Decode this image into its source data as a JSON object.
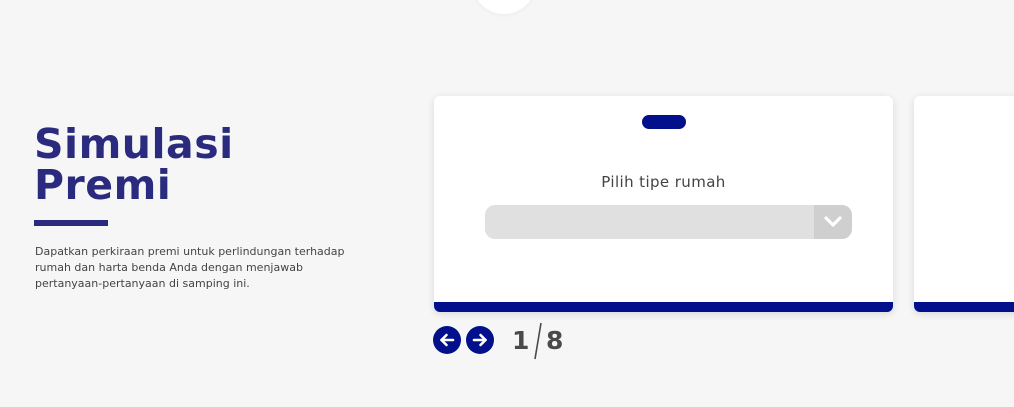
{
  "intro": {
    "title_line1": "Simulasi",
    "title_line2": "Premi",
    "description": "Dapatkan perkiraan premi untuk perlindungan terhadap rumah dan harta benda Anda dengan menjawab pertanyaan-pertanyaan di samping ini."
  },
  "question_card": {
    "label": "Pilih tipe rumah",
    "select": {
      "value": "",
      "icon": "chevron-down-icon"
    }
  },
  "pagination": {
    "current": "1",
    "total": "8",
    "prev_icon": "arrow-left-icon",
    "next_icon": "arrow-right-icon"
  },
  "colors": {
    "brand_navy": "#2a2a7e",
    "accent_blue": "#03108c",
    "background": "#f6f6f6",
    "select_bg": "#e0e0e0"
  }
}
